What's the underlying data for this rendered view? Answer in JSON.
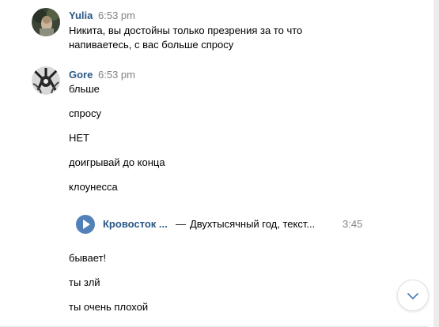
{
  "messages": [
    {
      "author": "Yulia",
      "time": "6:53 pm",
      "lines": [
        "Никита, вы достойны только презрения за то что",
        "напиваетесь, с вас больше спросу"
      ]
    },
    {
      "author": "Gore",
      "time": "6:53 pm",
      "lines": [
        "бльше",
        "спросу",
        "НЕТ",
        "доигрывай до конца",
        "клоунесса"
      ],
      "audio": {
        "artist": "Кровосток ...",
        "dash": "—",
        "title": "Двухтысячный год, текст...",
        "duration": "3:45",
        "play_icon": "play-icon"
      },
      "lines_after": [
        "бывает!",
        "ты злй",
        "ты очень плохой"
      ]
    }
  ],
  "scroll_down_icon": "chevron-down-icon",
  "colors": {
    "link": "#2a5885",
    "accent": "#5181b8",
    "muted": "#828282"
  }
}
